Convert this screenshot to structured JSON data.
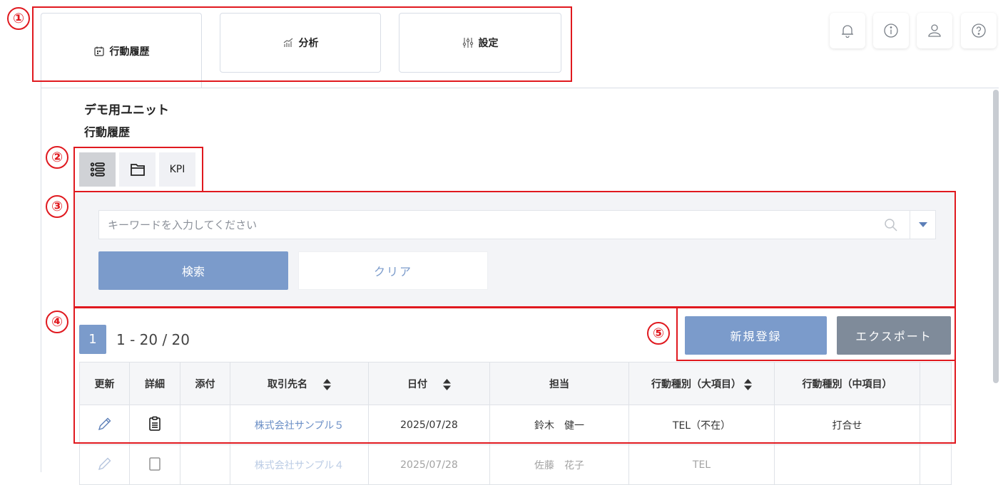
{
  "tabs": [
    {
      "label": "行動履歴",
      "icon": "calendar-icon"
    },
    {
      "label": "分析",
      "icon": "chart-icon"
    },
    {
      "label": "設定",
      "icon": "sliders-icon"
    }
  ],
  "header_icons": [
    "bell-icon",
    "info-icon",
    "user-icon",
    "help-icon"
  ],
  "unit_name": "デモ用ユニット",
  "page_subtitle": "行動履歴",
  "view_modes": [
    {
      "icon": "list-icon",
      "active": true
    },
    {
      "icon": "folder-icon",
      "active": false
    },
    {
      "label": "KPI",
      "active": false
    }
  ],
  "search": {
    "placeholder": "キーワードを入力してください",
    "search_label": "検索",
    "clear_label": "クリア"
  },
  "pagination": {
    "current": "1",
    "range": "1 - 20 / 20"
  },
  "actions": {
    "new_label": "新規登録",
    "export_label": "エクスポート"
  },
  "table": {
    "headers": [
      "更新",
      "詳細",
      "添付",
      "取引先名",
      "日付",
      "担当",
      "行動種別（大項目）",
      "行動種別（中項目）",
      ""
    ],
    "sortable": [
      false,
      false,
      false,
      true,
      true,
      false,
      true,
      false,
      false
    ],
    "rows": [
      {
        "company": "株式会社サンプル５",
        "date": "2025/07/28",
        "person": "鈴木　健一",
        "type_major": "TEL（不在）",
        "type_mid": "打合せ"
      },
      {
        "company": "株式会社サンプル４",
        "date": "2025/07/28",
        "person": "佐藤　花子",
        "type_major": "TEL",
        "type_mid": ""
      }
    ]
  },
  "annotations": [
    "①",
    "②",
    "③",
    "④",
    "⑤"
  ],
  "colors": {
    "accent": "#7b9bcb",
    "annotation": "#e0191f",
    "export": "#7f8b9a"
  }
}
